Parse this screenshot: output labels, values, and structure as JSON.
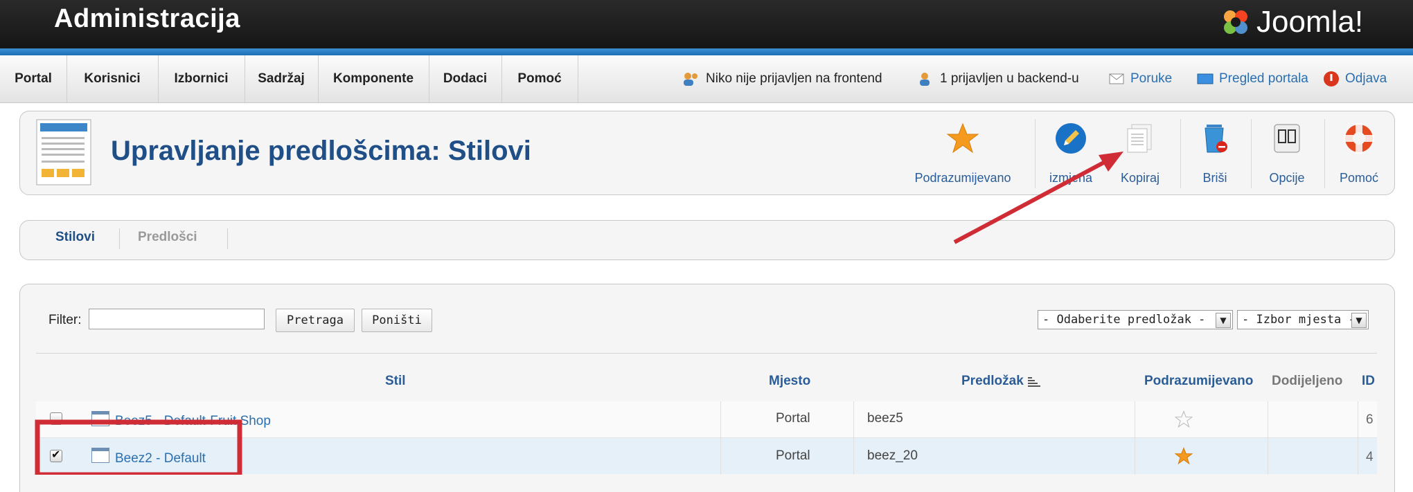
{
  "header": {
    "title": "Administracija",
    "brand": "Joomla!"
  },
  "menu": [
    "Portal",
    "Korisnici",
    "Izbornici",
    "Sadržaj",
    "Komponente",
    "Dodaci",
    "Pomoć"
  ],
  "status": {
    "frontend": "Niko nije prijavljen na frontend",
    "backend": "1 prijavljen u backend-u",
    "messages": "Poruke",
    "preview": "Pregled portala",
    "logout": "Odjava"
  },
  "page": {
    "title": "Upravljanje predlošcima: Stilovi"
  },
  "toolbar": {
    "default": "Podrazumijevano",
    "edit": "izmjena",
    "copy": "Kopiraj",
    "delete": "Briši",
    "options": "Opcije",
    "help": "Pomoć"
  },
  "tabs": {
    "styles": "Stilovi",
    "templates": "Predlošci"
  },
  "filter": {
    "label": "Filter:",
    "value": "",
    "search_btn": "Pretraga",
    "reset_btn": "Poništi",
    "template_select": "- Odaberite predložak -",
    "position_select": "- Izbor mjesta -"
  },
  "table": {
    "headers": {
      "style": "Stil",
      "location": "Mjesto",
      "template": "Predložak",
      "default": "Podrazumijevano",
      "assigned": "Dodijeljeno",
      "id": "ID"
    },
    "rows": [
      {
        "style": "Beez5 - Default-Fruit Shop",
        "location": "Portal",
        "template": "beez5",
        "is_default": false,
        "id": "6",
        "checked": false
      },
      {
        "style": "Beez2 - Default",
        "location": "Portal",
        "template": "beez_20",
        "is_default": true,
        "id": "4",
        "checked": true
      }
    ]
  },
  "colors": {
    "accent_red": "#cf2c35",
    "link_blue": "#2a6fb0",
    "title_blue": "#1f4f86"
  }
}
